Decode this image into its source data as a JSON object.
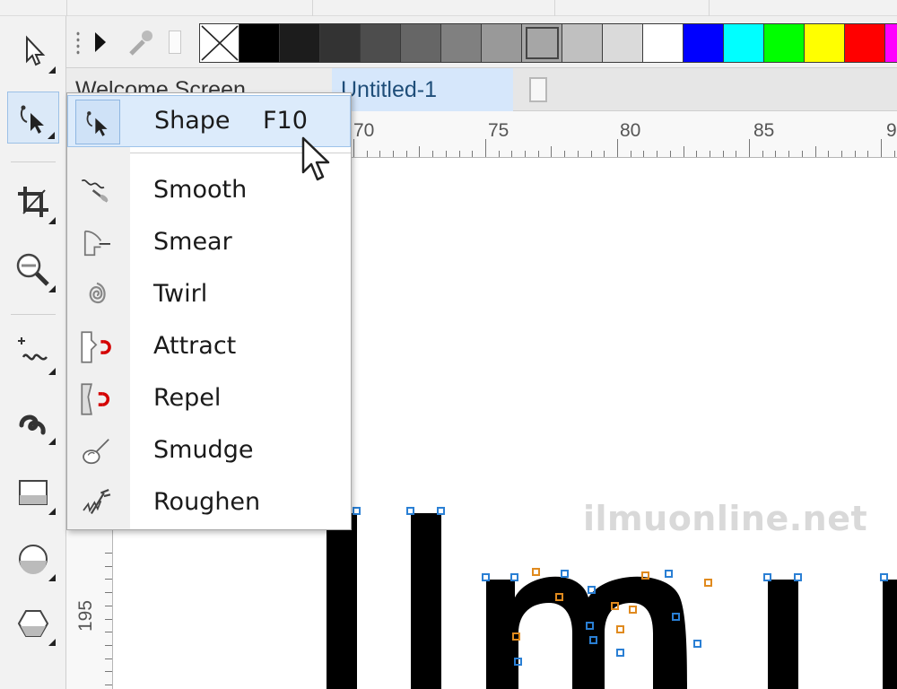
{
  "tabs": {
    "welcome": "Welcome Screen",
    "untitled": "Untitled-1"
  },
  "ruler": {
    "horizontal": [
      "70",
      "75",
      "80",
      "85",
      "9"
    ],
    "vertical": [
      "195"
    ]
  },
  "flyout": {
    "items": [
      {
        "label": "Shape",
        "shortcut": "F10",
        "icon": "shape-icon"
      },
      {
        "label": "Smooth",
        "icon": "smooth-icon"
      },
      {
        "label": "Smear",
        "icon": "smear-icon"
      },
      {
        "label": "Twirl",
        "icon": "twirl-icon"
      },
      {
        "label": "Attract",
        "icon": "attract-icon"
      },
      {
        "label": "Repel",
        "icon": "repel-icon"
      },
      {
        "label": "Smudge",
        "icon": "smudge-icon"
      },
      {
        "label": "Roughen",
        "icon": "roughen-icon"
      }
    ]
  },
  "palette": {
    "colors": [
      "none",
      "#000000",
      "#1c1c1c",
      "#333333",
      "#4d4d4d",
      "#666666",
      "#808080",
      "#999999",
      "#a6a6a6",
      "#c0c0c0",
      "#dadada",
      "#ffffff",
      "#0000ff",
      "#00ffff",
      "#00ff00",
      "#ffff00",
      "#ff0000",
      "#ff00ff"
    ]
  },
  "toolbox": {
    "tools": [
      "pick-tool",
      "shape-tool",
      "crop-tool",
      "zoom-tool",
      "freehand-tool",
      "artistic-media-tool",
      "rectangle-tool",
      "ellipse-tool",
      "polygon-tool"
    ]
  },
  "watermark": "ilmuonline.net"
}
